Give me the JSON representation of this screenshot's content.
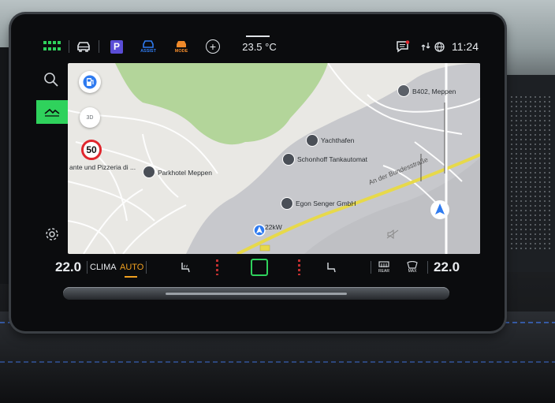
{
  "statusbar": {
    "assist_label": "ASSIST",
    "mode_label": "MODE",
    "parking_label": "P",
    "temperature": "23.5 °C",
    "time": "11:24",
    "add_symbol": "+"
  },
  "map": {
    "pois": {
      "meppen": "B402, Meppen",
      "yachthafen": "Yachthafen",
      "tank": "Schonhoff Tankautomat",
      "hotel": "Parkhotel Meppen",
      "pizzeria": "ante und Pizzeria di ...",
      "egon": "Egon Senger GmbH",
      "charging": "22kW",
      "street": "An der Bundesstraße"
    },
    "speed_limit": "50",
    "sign_3d": "3D"
  },
  "bottombar": {
    "temp_left": "22.0",
    "clima_label": "CLIMA",
    "auto_label": "AUTO",
    "rear_label": "REAR",
    "max_label": "MAX",
    "temp_right": "22.0"
  },
  "colors": {
    "accent_green": "#2fd25c",
    "assist_blue": "#2f7bf0",
    "mode_orange": "#f08a2a",
    "auto_orange": "#f0a020",
    "parking_purple": "#5a4dd6",
    "route_yellow": "#e7d94a"
  }
}
